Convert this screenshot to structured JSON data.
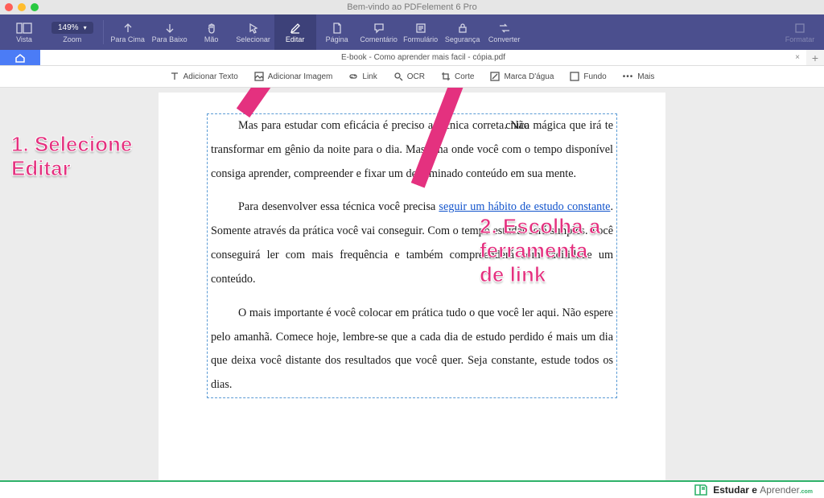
{
  "window": {
    "title": "Bem-vindo ao PDFelement 6 Pro"
  },
  "toolbar": {
    "vista": "Vista",
    "zoom": "Zoom",
    "zoom_value": "149%",
    "para_cima": "Para Cima",
    "para_baixo": "Para Baixo",
    "mao": "Mão",
    "selecionar": "Selecionar",
    "editar": "Editar",
    "pagina": "Página",
    "comentario": "Comentário",
    "formulario": "Formulário",
    "seguranca": "Segurança",
    "converter": "Converter",
    "formatar": "Formatar"
  },
  "tabs": {
    "doc_title": "E-book - Como aprender mais facil - cópia.pdf"
  },
  "subtoolbar": {
    "adicionar_texto": "Adicionar Texto",
    "adicionar_imagem": "Adicionar Imagem",
    "link": "Link",
    "ocr": "OCR",
    "corte": "Corte",
    "marca_dagua": "Marca D'água",
    "fundo": "Fundo",
    "mais": "Mais"
  },
  "document": {
    "p1_a": "Mas para estudar com eficácia é preciso a técnica correta. Não ",
    "p1_b": "cnica mágica que irá te transformar em gênio da noite para o dia. Mas uma onde você com o tempo disponível consiga aprender, compreender e fixar um determinado conteúdo em sua mente.",
    "p2_a": "Para desenvolver essa técnica você precisa ",
    "p2_link": "seguir um hábito de estudo constante",
    "p2_b": ". Somente através da prática você vai conseguir. Com o tempo estudar será simples. Você conseguirá ler com mais frequência e também compreenderá com facilidade um conteúdo.",
    "p3": "O mais importante é você colocar em prática tudo o que você ler aqui. Não espere pelo amanhã. Comece hoje, lembre-se que a cada dia de estudo perdido é mais um dia que deixa você distante dos resultados que você quer. Seja constante, estude todos os dias."
  },
  "annotations": {
    "step1": "1. Selecione\nEditar",
    "step2": "2. Escolha a\nferramenta\nde link"
  },
  "footer": {
    "brand_a": "Estudar e ",
    "brand_b": "Aprender",
    "brand_c": ".com"
  }
}
